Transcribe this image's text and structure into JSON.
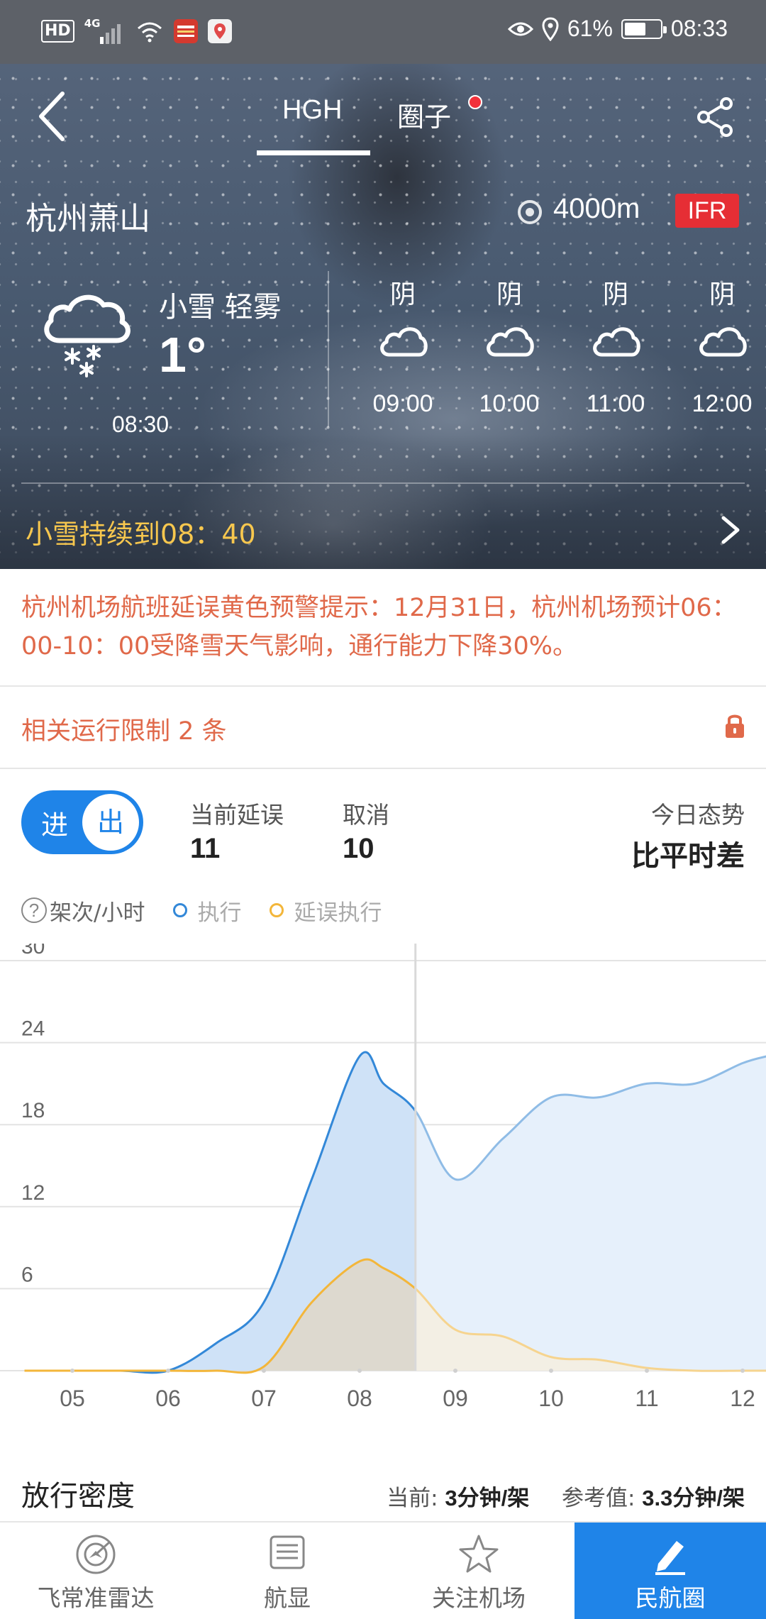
{
  "status_bar": {
    "hd": "HD",
    "network": "4G",
    "battery_percent": "61%",
    "battery_level": 0.61,
    "time": "08:33"
  },
  "header": {
    "tabs": [
      "HGH",
      "圈子"
    ],
    "active_tab": "HGH"
  },
  "airport": {
    "city": "杭州萧山",
    "visibility": "4000m",
    "flight_rule": "IFR"
  },
  "weather_now": {
    "condition": "小雪 轻雾",
    "temperature": "1°",
    "time": "08:30"
  },
  "forecast": [
    {
      "condition": "阴",
      "time": "09:00"
    },
    {
      "condition": "阴",
      "time": "10:00"
    },
    {
      "condition": "阴",
      "time": "11:00"
    },
    {
      "condition": "阴",
      "time": "12:00"
    }
  ],
  "snow_message": "小雪持续到08：40",
  "alert": "杭州机场航班延误黄色预警提示：12月31日，杭州机场预计06：00-10：00受降雪天气影响，通行能力下降30%。",
  "restriction": "相关运行限制 2 条",
  "toggle": {
    "in": "进",
    "out": "出"
  },
  "stats": {
    "delay_label": "当前延误",
    "delay_value": "11",
    "cancel_label": "取消",
    "cancel_value": "10",
    "trend_label": "今日态势",
    "trend_value": "比平时差"
  },
  "legend": {
    "unit": "架次/小时",
    "series1": "执行",
    "series2": "延误执行"
  },
  "chart_data": {
    "type": "area",
    "x": [
      "04:30",
      "05:00",
      "05:30",
      "06:00",
      "06:30",
      "07:00",
      "07:30",
      "08:00",
      "08:15",
      "08:35",
      "09:00",
      "09:30",
      "10:00",
      "10:30",
      "11:00",
      "11:30",
      "12:00",
      "12:15"
    ],
    "categories": [
      "05",
      "06",
      "07",
      "08",
      "09",
      "10",
      "11",
      "12"
    ],
    "yticks": [
      "30",
      "24",
      "18",
      "12",
      "6"
    ],
    "ylim": [
      0,
      30
    ],
    "current_time": "08:35",
    "series": [
      {
        "name": "执行",
        "color": "#3388d8",
        "values": [
          0,
          0,
          0,
          0,
          2,
          5,
          14,
          23,
          21,
          19,
          14,
          17,
          20,
          20,
          21,
          21,
          22.5,
          23
        ]
      },
      {
        "name": "延误执行",
        "color": "#f3b63a",
        "values": [
          0,
          0,
          0,
          0,
          0,
          0.3,
          5,
          8,
          7.5,
          6,
          3,
          2.5,
          1,
          0.8,
          0.2,
          0,
          0,
          0
        ]
      }
    ]
  },
  "density": {
    "title": "放行密度",
    "current_label": "当前:",
    "current_value": "3分钟/架",
    "ref_label": "参考值:",
    "ref_value": "3.3分钟/架"
  },
  "nav": [
    {
      "label": "飞常准雷达",
      "icon": "radar-icon"
    },
    {
      "label": "航显",
      "icon": "flight-board-icon"
    },
    {
      "label": "关注机场",
      "icon": "star-icon"
    },
    {
      "label": "民航圈",
      "icon": "pen-icon"
    }
  ],
  "colors": {
    "accent": "#1f84e8",
    "alert": "#e0694a",
    "ifr": "#e62e35",
    "snow_text": "#f7c74e"
  }
}
